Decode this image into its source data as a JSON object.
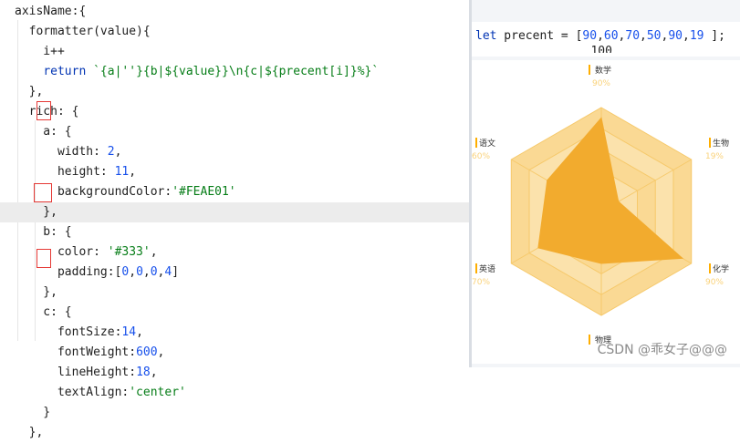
{
  "editor": {
    "lines": [
      {
        "segments": [
          {
            "t": "axisName:{",
            "c": "prop"
          }
        ]
      },
      {
        "segments": [
          {
            "t": "  formatter(value){",
            "c": "prop"
          }
        ]
      },
      {
        "segments": [
          {
            "t": "    i++",
            "c": "prop"
          }
        ]
      },
      {
        "segments": [
          {
            "t": "    ",
            "c": "prop"
          },
          {
            "t": "return",
            "c": "kw"
          },
          {
            "t": " ",
            "c": "prop"
          },
          {
            "t": "`{a|''}{b|${value}}\\n{c|${precent[i]}%}`",
            "c": "str"
          }
        ]
      },
      {
        "segments": [
          {
            "t": "  },",
            "c": "prop"
          }
        ]
      },
      {
        "segments": [
          {
            "t": "  rich: {",
            "c": "prop"
          }
        ]
      },
      {
        "segments": [
          {
            "t": "    a: {",
            "c": "prop"
          }
        ]
      },
      {
        "segments": [
          {
            "t": "      width: ",
            "c": "prop"
          },
          {
            "t": "2",
            "c": "num"
          },
          {
            "t": ",",
            "c": "prop"
          }
        ]
      },
      {
        "segments": [
          {
            "t": "      height: ",
            "c": "prop"
          },
          {
            "t": "11",
            "c": "num"
          },
          {
            "t": ",",
            "c": "prop"
          }
        ]
      },
      {
        "segments": [
          {
            "t": "      backgroundColor:",
            "c": "prop"
          },
          {
            "t": "'#FEAE01'",
            "c": "str"
          }
        ]
      },
      {
        "segments": [
          {
            "t": "    },",
            "c": "prop"
          }
        ]
      },
      {
        "segments": [
          {
            "t": "    b: {",
            "c": "prop"
          }
        ]
      },
      {
        "segments": [
          {
            "t": "      color: ",
            "c": "prop"
          },
          {
            "t": "'#333'",
            "c": "str"
          },
          {
            "t": ",",
            "c": "prop"
          }
        ]
      },
      {
        "segments": [
          {
            "t": "      padding:[",
            "c": "prop"
          },
          {
            "t": "0",
            "c": "num"
          },
          {
            "t": ",",
            "c": "prop"
          },
          {
            "t": "0",
            "c": "num"
          },
          {
            "t": ",",
            "c": "prop"
          },
          {
            "t": "0",
            "c": "num"
          },
          {
            "t": ",",
            "c": "prop"
          },
          {
            "t": "4",
            "c": "num"
          },
          {
            "t": "]",
            "c": "prop"
          }
        ]
      },
      {
        "segments": [
          {
            "t": "    },",
            "c": "prop"
          }
        ]
      },
      {
        "segments": [
          {
            "t": "    c: {",
            "c": "prop"
          }
        ]
      },
      {
        "segments": [
          {
            "t": "      fontSize:",
            "c": "prop"
          },
          {
            "t": "14",
            "c": "num"
          },
          {
            "t": ",",
            "c": "prop"
          }
        ]
      },
      {
        "segments": [
          {
            "t": "      fontWeight:",
            "c": "prop"
          },
          {
            "t": "600",
            "c": "num"
          },
          {
            "t": ",",
            "c": "prop"
          }
        ]
      },
      {
        "segments": [
          {
            "t": "      lineHeight:",
            "c": "prop"
          },
          {
            "t": "18",
            "c": "num"
          },
          {
            "t": ",",
            "c": "prop"
          }
        ]
      },
      {
        "segments": [
          {
            "t": "      textAlign:",
            "c": "prop"
          },
          {
            "t": "'center'",
            "c": "str"
          }
        ]
      },
      {
        "segments": [
          {
            "t": "    }",
            "c": "prop"
          }
        ]
      },
      {
        "segments": [
          {
            "t": "  },",
            "c": "prop"
          }
        ]
      }
    ],
    "highlighted_line": 10
  },
  "snippet": {
    "segments": [
      {
        "t": "let",
        "c": "kw"
      },
      {
        "t": " precent = [",
        "c": "prop"
      },
      {
        "t": "90",
        "c": "num"
      },
      {
        "t": ",",
        "c": "prop"
      },
      {
        "t": "60",
        "c": "num"
      },
      {
        "t": ",",
        "c": "prop"
      },
      {
        "t": "70",
        "c": "num"
      },
      {
        "t": ",",
        "c": "prop"
      },
      {
        "t": "50",
        "c": "num"
      },
      {
        "t": ",",
        "c": "prop"
      },
      {
        "t": "90",
        "c": "num"
      },
      {
        "t": ",",
        "c": "prop"
      },
      {
        "t": "19",
        "c": "num"
      },
      {
        "t": " ];",
        "c": "prop"
      }
    ],
    "clipped_text": "    ...  100"
  },
  "watermark": "CSDN @乖女子@@@",
  "colors": {
    "accent": "#FEAE01",
    "radar_fill": "#F2AB2E",
    "radar_bg_outer": "#FAD994",
    "radar_bg_inner": "#FBE2AC",
    "radar_line": "#F6C96B",
    "percent_text": "#FAD27A",
    "label_text": "#333333",
    "key_box": "#E53935"
  },
  "chart_data": {
    "type": "radar",
    "indicators": [
      {
        "name": "数学",
        "percent": "90%"
      },
      {
        "name": "生物",
        "percent": "19%"
      },
      {
        "name": "化学",
        "percent": "90%"
      },
      {
        "name": "物理",
        "percent": ""
      },
      {
        "name": "英语",
        "percent": "70%"
      },
      {
        "name": "语文",
        "percent": "60%"
      }
    ],
    "series": [
      {
        "values": [
          0.9,
          0.19,
          0.9,
          0.5,
          0.7,
          0.6
        ]
      }
    ],
    "max": 1,
    "split_number": 5
  }
}
